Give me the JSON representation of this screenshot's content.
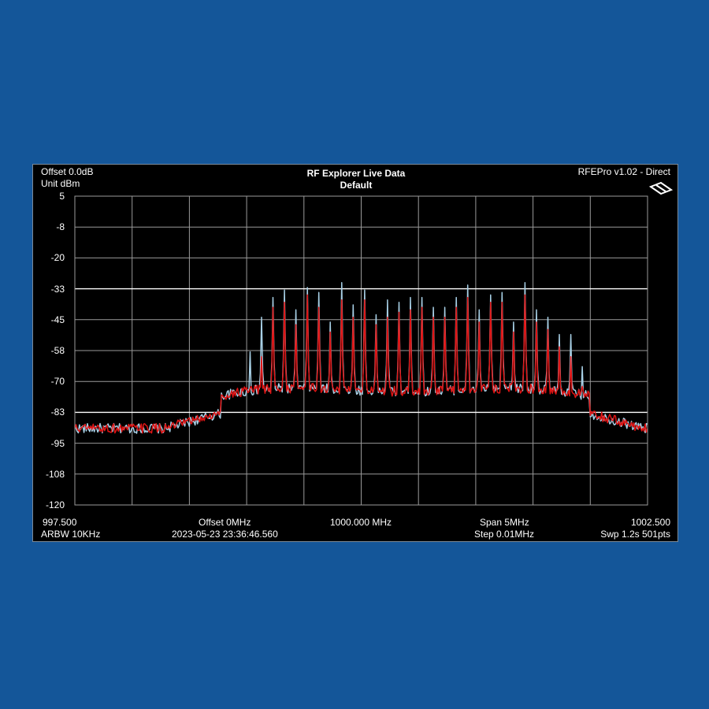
{
  "header": {
    "offset": "Offset 0.0dB",
    "unit": "Unit dBm",
    "title": "RF Explorer Live Data",
    "subtitle": "Default",
    "device": "RFEPro v1.02 - Direct"
  },
  "footer": {
    "start_freq": "997.500",
    "offset_freq": "Offset 0MHz",
    "center_freq": "1000.000 MHz",
    "span": "Span 5MHz",
    "stop_freq": "1002.500",
    "rbw": "ARBW 10KHz",
    "timestamp": "2023-05-23 23:36:46.560",
    "step": "Step 0.01MHz",
    "sweep": "Swp 1.2s  501pts"
  },
  "colors": {
    "background": "#145699",
    "plot_background": "#000000",
    "grid": "#9a9a9a",
    "highlight_grid": "#ffffff",
    "trace_realtime": "#a8d0e6",
    "trace_maxhold": "#e01414"
  },
  "chart_data": {
    "type": "line",
    "xlim": [
      997.5,
      1002.5
    ],
    "ylim": [
      -120,
      5
    ],
    "yticks": [
      5,
      -8,
      -20,
      -33,
      -45,
      -58,
      -70,
      -83,
      -95,
      -108,
      -120
    ],
    "highlighted_yticks": [
      -33,
      -83
    ],
    "x_gridlines": 10,
    "grid": true,
    "noise_floor_dbm": -89,
    "peaks_start_mhz": 998.83,
    "peak_spacing_mhz": 0.1,
    "peak_count": 32,
    "series": [
      {
        "key": "realtime",
        "peak_levels_dbm": [
          -80,
          -77,
          -58,
          -44,
          -36,
          -33,
          -41,
          -32,
          -34,
          -46,
          -30,
          -39,
          -33,
          -43,
          -37,
          -38,
          -36,
          -36,
          -40,
          -40,
          -36,
          -31,
          -41,
          -35,
          -34,
          -46,
          -30,
          -41,
          -44,
          -51,
          -51,
          -64
        ]
      },
      {
        "key": "maxhold",
        "peak_levels_dbm": [
          -85,
          -82,
          -73,
          -60,
          -40,
          -38,
          -47,
          -35,
          -40,
          -50,
          -37,
          -44,
          -37,
          -47,
          -44,
          -42,
          -41,
          -40,
          -44,
          -44,
          -40,
          -36,
          -46,
          -38,
          -38,
          -50,
          -35,
          -46,
          -49,
          -56,
          -60,
          -72
        ]
      }
    ]
  }
}
